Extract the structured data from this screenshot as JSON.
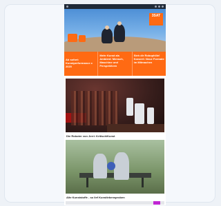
{
  "hero": {
    "badge": "3SAT",
    "alt": "Mann mit Sonnenbrille"
  },
  "promo": [
    {
      "text": "Ab sofort: Kunstperformance x 2020"
    },
    {
      "text": "Mehr Kunst als Ambient: Mensch, Maschine und Perspektiven"
    },
    {
      "text": "Sieh dir Robophilie! Konzert: Neue Formate im Mitmachen"
    }
  ],
  "articles": [
    {
      "caption": "Die Roboter von Jerri: Kritisch/Kunst"
    },
    {
      "caption": "Alte Kunststoffe - so lief Kunstlebensproben"
    }
  ],
  "colors": {
    "accent": "#ff6a13",
    "footer_accent": "#c026d3"
  }
}
